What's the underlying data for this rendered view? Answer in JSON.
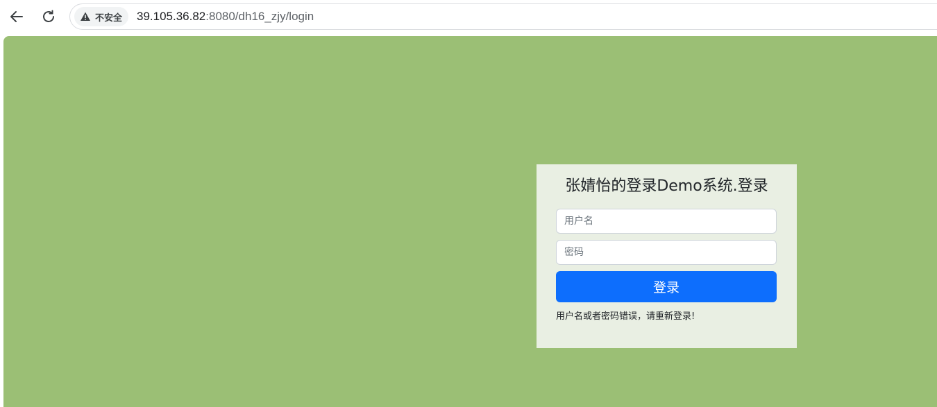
{
  "browser": {
    "security_label": "不安全",
    "url_host": "39.105.36.82",
    "url_path": ":8080/dh16_zjy/login",
    "icons": {
      "back": "arrow-left-icon",
      "reload": "reload-icon",
      "security": "warning-triangle-icon"
    }
  },
  "page": {
    "background_color": "#9bbf75",
    "login": {
      "title": "张婧怡的登录Demo系统.登录",
      "username_placeholder": "用户名",
      "password_placeholder": "密码",
      "submit_label": "登录",
      "error_message": "用户名或者密码错误，请重新登录!",
      "panel_color": "#e9efe3",
      "button_color": "#0d6efd"
    }
  }
}
